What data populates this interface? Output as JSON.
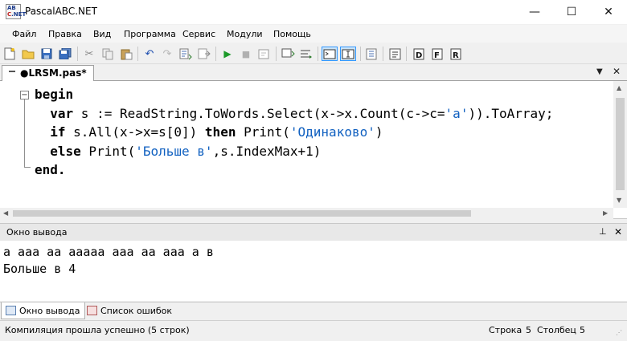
{
  "window": {
    "title": "PascalABC.NET",
    "controls": {
      "minimize": "—",
      "maximize": "☐",
      "close": "✕"
    }
  },
  "menu": [
    "Файл",
    "Правка",
    "Вид",
    "Программа",
    "Сервис",
    "Модули",
    "Помощь"
  ],
  "toolbar": {
    "icons": [
      "new-file-icon",
      "open-icon",
      "save-icon",
      "save-all-icon",
      "cut-icon",
      "copy-icon",
      "paste-icon",
      "undo-icon",
      "redo-icon",
      "format-icon",
      "navigate-icon",
      "run-icon",
      "stop-icon",
      "step-icon",
      "step-over-icon",
      "output-window-icon",
      "input-icon",
      "debug-icon",
      "compile-icon",
      "tool-a-icon",
      "tool-b-icon",
      "tool-c-icon"
    ]
  },
  "editor": {
    "tab_label": "●LRSM.pas*",
    "code": {
      "line1": {
        "kw": "begin"
      },
      "line2": {
        "kw": "var",
        "a": " s := ReadString.ToWords.Select(x->x.Count(c->c=",
        "str": "'a'",
        "b": ")).ToArray;"
      },
      "line3": {
        "kw1": "if",
        "a": " s.All(x->x=s[0]) ",
        "kw2": "then",
        "b": " Print(",
        "str": "'Одинаково'",
        "c": ")"
      },
      "line4": {
        "kw": "else",
        "a": " Print(",
        "str": "'Больше в'",
        "b": ",s.IndexMax+1)"
      },
      "line5": {
        "kw": "end",
        "a": "."
      }
    }
  },
  "output": {
    "header": "Окно вывода",
    "pin": "📌",
    "close": "✕",
    "lines": [
      "а ааа аа ааааа ааа аа ааа а в",
      "Больше в 4"
    ]
  },
  "bottom_tabs": [
    "Окно вывода",
    "Список ошибок"
  ],
  "status": {
    "message": "Компиляция прошла успешно (5 строк)",
    "line_label": "Строка",
    "line_value": "5",
    "col_label": "Столбец",
    "col_value": "5"
  }
}
